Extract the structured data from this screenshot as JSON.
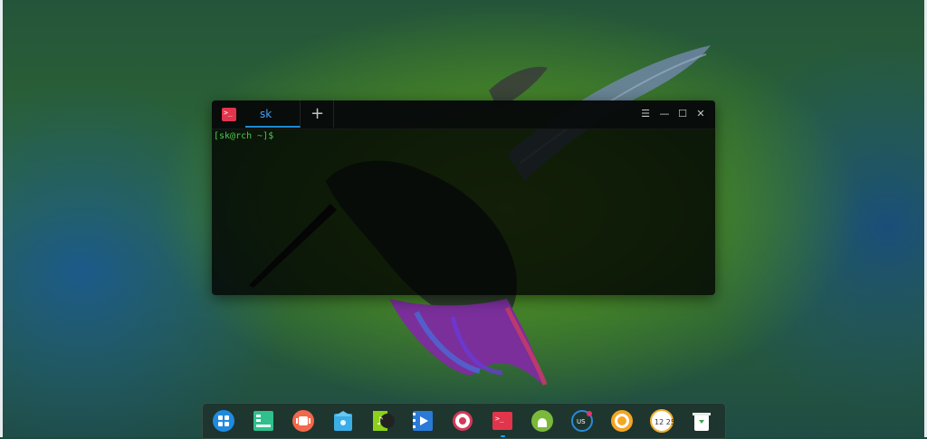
{
  "terminal": {
    "tab_label": "sk",
    "new_tab_symbol": "+",
    "prompt": "[sk@rch ~]$",
    "window_buttons": {
      "menu": "☰",
      "minimize": "—",
      "maximize": "☐",
      "close": "✕"
    }
  },
  "dock": {
    "items": [
      {
        "name": "launcher-icon"
      },
      {
        "name": "file-manager-icon"
      },
      {
        "name": "multitasking-icon"
      },
      {
        "name": "app-store-icon"
      },
      {
        "name": "music-icon"
      },
      {
        "name": "movie-icon"
      },
      {
        "name": "settings-icon"
      },
      {
        "name": "terminal-icon",
        "active": true
      },
      {
        "name": "android-icon"
      },
      {
        "name": "keyboard-layout-icon",
        "label": "US"
      },
      {
        "name": "shutdown-icon"
      },
      {
        "name": "clock-icon",
        "label": "12 25"
      },
      {
        "name": "trash-icon"
      }
    ]
  },
  "colors": {
    "accent": "#1e8ad6",
    "prompt": "#4ec94e",
    "terminal_icon": "#e2354c"
  }
}
